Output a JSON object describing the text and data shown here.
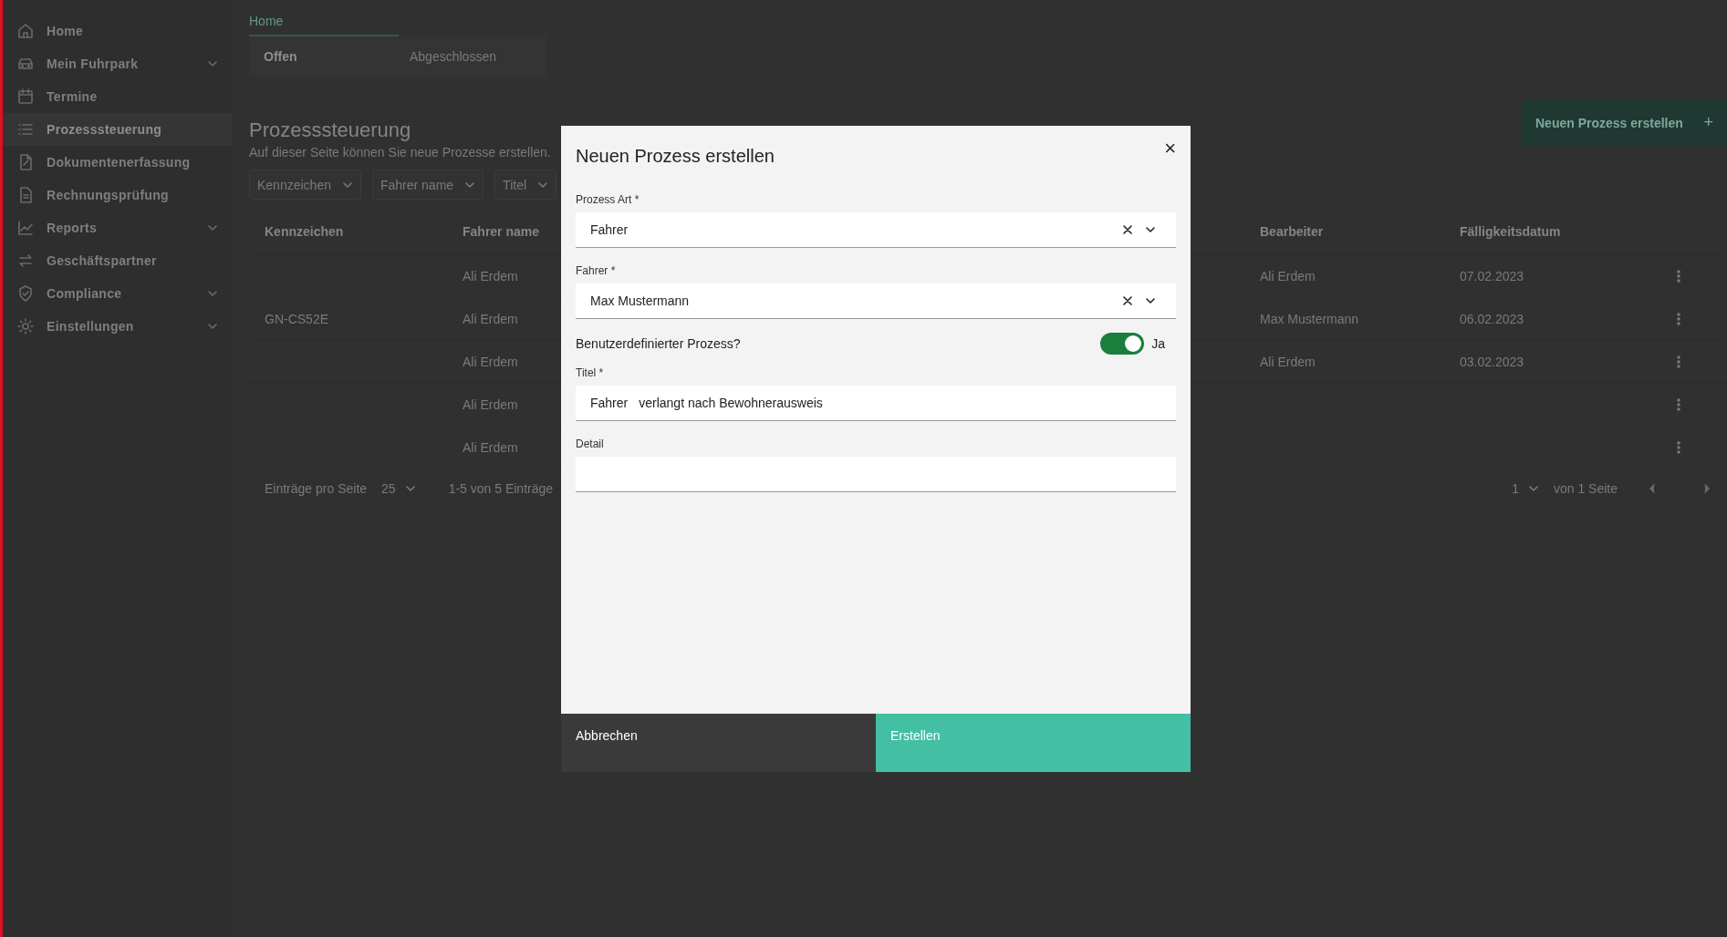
{
  "sidebar": {
    "items": [
      {
        "label": "Home",
        "expandable": false,
        "selected": false
      },
      {
        "label": "Mein Fuhrpark",
        "expandable": true,
        "selected": false
      },
      {
        "label": "Termine",
        "expandable": false,
        "selected": false
      },
      {
        "label": "Prozesssteuerung",
        "expandable": false,
        "selected": true
      },
      {
        "label": "Dokumentenerfassung",
        "expandable": false,
        "selected": false
      },
      {
        "label": "Rechnungsprüfung",
        "expandable": false,
        "selected": false
      },
      {
        "label": "Reports",
        "expandable": true,
        "selected": false
      },
      {
        "label": "Geschäftspartner",
        "expandable": false,
        "selected": false
      },
      {
        "label": "Compliance",
        "expandable": true,
        "selected": false
      },
      {
        "label": "Einstellungen",
        "expandable": true,
        "selected": false
      }
    ]
  },
  "breadcrumb": "Home",
  "tabs": [
    {
      "label": "Offen",
      "selected": true
    },
    {
      "label": "Abgeschlossen",
      "selected": false
    }
  ],
  "page": {
    "title": "Prozesssteuerung",
    "subtitle": "Auf dieser Seite können Sie neue Prozesse erstellen.",
    "create_button": "Neuen Prozess erstellen",
    "create_icon": "+"
  },
  "filters": [
    "Kennzeichen",
    "Fahrer name",
    "Titel"
  ],
  "table": {
    "columns": [
      "Kennzeichen",
      "Fahrer name",
      "Bearbeiter",
      "Fälligkeitsdatum"
    ],
    "rows": [
      [
        "",
        "Ali Erdem",
        "Ali Erdem",
        "07.02.2023"
      ],
      [
        "GN-CS52E",
        "Ali Erdem",
        "Max Mustermann",
        "06.02.2023"
      ],
      [
        "",
        "Ali Erdem",
        "Ali Erdem",
        "03.02.2023"
      ],
      [
        "",
        "Ali Erdem",
        "",
        ""
      ],
      [
        "",
        "Ali Erdem",
        "",
        ""
      ]
    ]
  },
  "pagination": {
    "per_page_label": "Einträge pro Seite",
    "per_page": "25",
    "range": "1-5 von 5 Einträge",
    "page": "1",
    "of_pages": "von 1 Seite"
  },
  "dialog": {
    "title": "Neuen Prozess erstellen",
    "close": "×",
    "fields": [
      {
        "kind": "select",
        "label": "Prozess Art *",
        "value": "Fahrer"
      },
      {
        "kind": "select",
        "label": "Fahrer *",
        "value": "Max Mustermann"
      },
      {
        "kind": "toggle",
        "label": "Benutzerdefinierter Prozess?",
        "on": true,
        "state_label": "Ja"
      },
      {
        "kind": "text",
        "label": "Titel *",
        "prefix": "Fahrer",
        "value": "verlangt nach Bewohnerausweis"
      },
      {
        "kind": "text",
        "label": "Detail"
      }
    ],
    "buttons": [
      {
        "label": "Abbrechen",
        "kind": "cancel"
      },
      {
        "label": "Erstellen",
        "kind": "primary"
      }
    ]
  }
}
